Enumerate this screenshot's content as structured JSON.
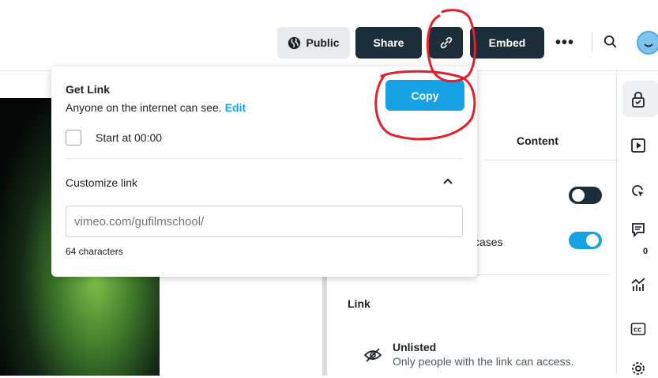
{
  "header": {
    "public_label": "Public",
    "share_label": "Share",
    "embed_label": "Embed",
    "more_label": "•••"
  },
  "popup": {
    "title": "Get Link",
    "subtitle": "Anyone on the internet can see.",
    "edit_label": "Edit",
    "copy_label": "Copy",
    "start_at_label": "Start at 00:00",
    "customize_label": "Customize link",
    "url_placeholder": "vimeo.com/gufilmschool/",
    "char_count": "64 characters"
  },
  "panel": {
    "content_tab": "Content",
    "cases_text": "cases",
    "link_label": "Link",
    "unlisted_title": "Unlisted",
    "unlisted_desc": "Only people with the link can access."
  },
  "rightbar": {
    "comments_badge": "0"
  },
  "colors": {
    "accent": "#17a2e5",
    "dark_button": "#1b2e39",
    "annotation": "#e0202a"
  }
}
